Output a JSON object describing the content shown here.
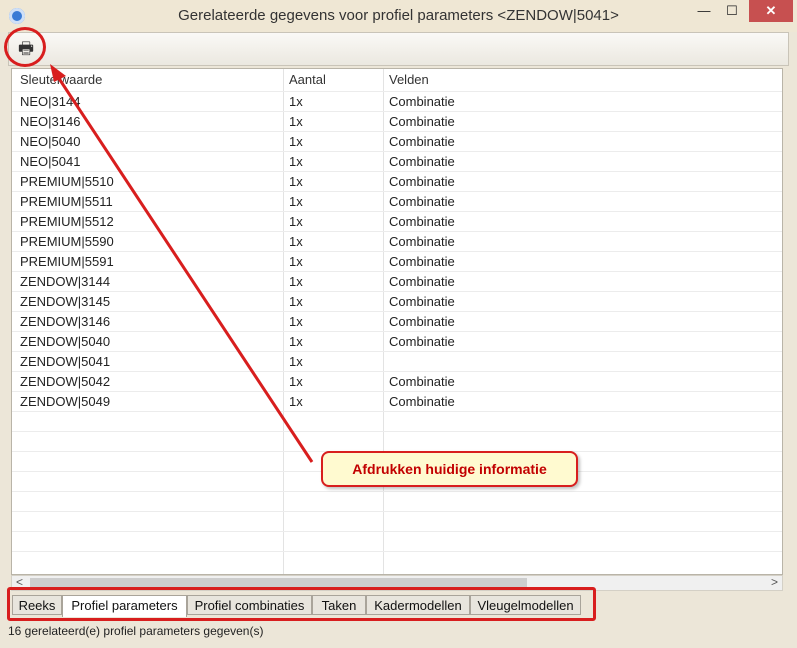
{
  "window": {
    "title": "Gerelateerde gegevens voor profiel parameters <ZENDOW|5041>",
    "minimize_label": "—",
    "maximize_label": "☐",
    "close_label": "✕"
  },
  "toolbar": {
    "print_icon": "printer-icon",
    "print_glyph": "🖶"
  },
  "grid": {
    "columns": [
      "Sleutelwaarde",
      "Aantal",
      "Velden"
    ],
    "rows": [
      [
        "NEO|3144",
        "1x",
        "Combinatie"
      ],
      [
        "NEO|3146",
        "1x",
        "Combinatie"
      ],
      [
        "NEO|5040",
        "1x",
        "Combinatie"
      ],
      [
        "NEO|5041",
        "1x",
        "Combinatie"
      ],
      [
        "PREMIUM|5510",
        "1x",
        "Combinatie"
      ],
      [
        "PREMIUM|5511",
        "1x",
        "Combinatie"
      ],
      [
        "PREMIUM|5512",
        "1x",
        "Combinatie"
      ],
      [
        "PREMIUM|5590",
        "1x",
        "Combinatie"
      ],
      [
        "PREMIUM|5591",
        "1x",
        "Combinatie"
      ],
      [
        "ZENDOW|3144",
        "1x",
        "Combinatie"
      ],
      [
        "ZENDOW|3145",
        "1x",
        "Combinatie"
      ],
      [
        "ZENDOW|3146",
        "1x",
        "Combinatie"
      ],
      [
        "ZENDOW|5040",
        "1x",
        "Combinatie"
      ],
      [
        "ZENDOW|5041",
        "1x",
        ""
      ],
      [
        "ZENDOW|5042",
        "1x",
        "Combinatie"
      ],
      [
        "ZENDOW|5049",
        "1x",
        "Combinatie"
      ]
    ]
  },
  "scrollbar": {
    "left_arrow": "<",
    "right_arrow": ">"
  },
  "tabs": [
    {
      "label": "Reeks",
      "active": false
    },
    {
      "label": "Profiel parameters",
      "active": true
    },
    {
      "label": "Profiel combinaties",
      "active": false
    },
    {
      "label": "Taken",
      "active": false
    },
    {
      "label": "Kadermodellen",
      "active": false
    },
    {
      "label": "Vleugelmodellen",
      "active": false
    }
  ],
  "status": "16 gerelateerd(e) profiel parameters gegeven(s)",
  "annotation": {
    "callout_text": "Afdrukken huidige informatie",
    "color": "#d81e1e"
  }
}
